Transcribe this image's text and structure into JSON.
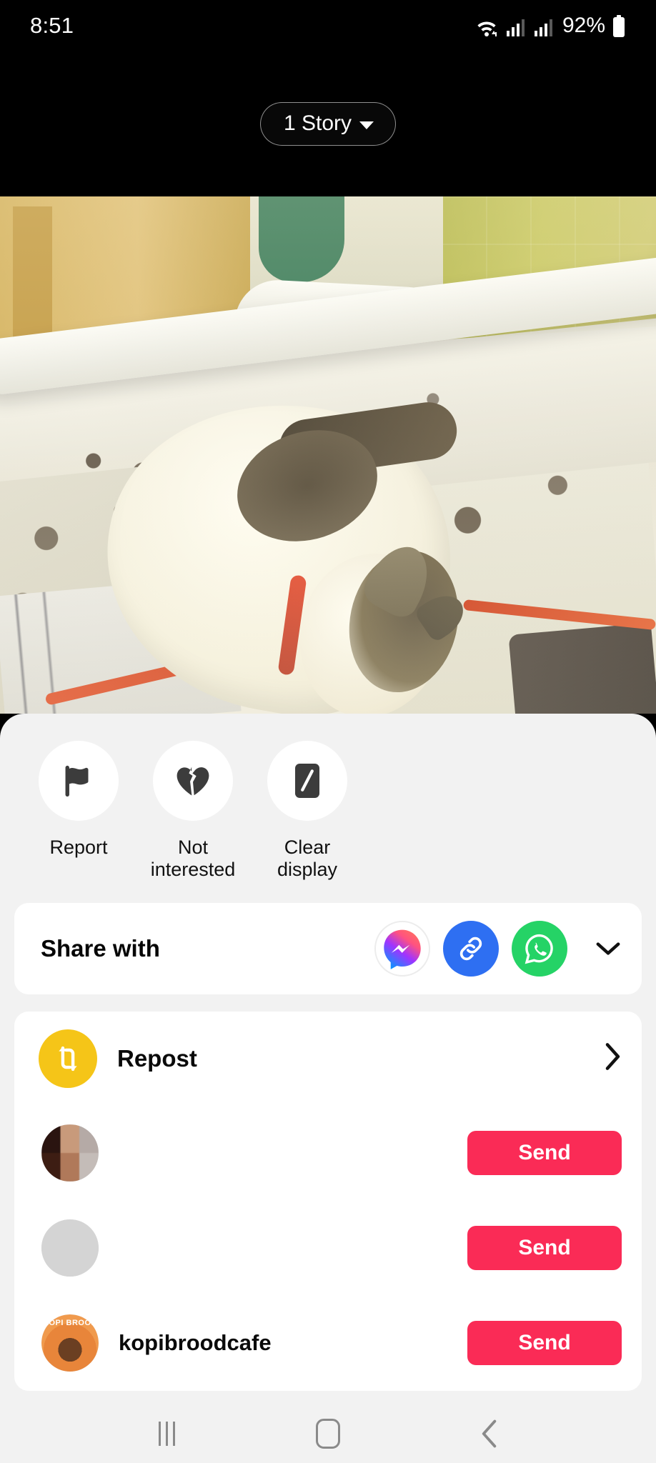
{
  "status_bar": {
    "time": "8:51",
    "battery_percent": "92%",
    "icons": [
      "wifi-icon",
      "signal-icon",
      "signal-icon",
      "battery-icon"
    ]
  },
  "story_header": {
    "label": "1 Story",
    "dropdown_icon": "caret-down-icon"
  },
  "media": {
    "type": "story-photo",
    "description": "White cat with brown tabby markings sleeping on a patterned bed sheet"
  },
  "quick_actions": [
    {
      "label": "Report",
      "icon": "flag-icon"
    },
    {
      "label": "Not\ninterested",
      "label_line1": "Not",
      "label_line2": "interested",
      "icon": "broken-heart-icon"
    },
    {
      "label": "Clear display",
      "label_line1": "Clear",
      "label_line2": "display",
      "icon": "clear-display-icon"
    }
  ],
  "share": {
    "title": "Share with",
    "targets": [
      {
        "name": "Messenger",
        "icon": "messenger-icon",
        "color": "#a033ff"
      },
      {
        "name": "Copy link",
        "icon": "link-icon",
        "color": "#2e6ff2"
      },
      {
        "name": "WhatsApp",
        "icon": "whatsapp-icon",
        "color": "#25d366"
      }
    ],
    "expand_icon": "chevron-down-icon"
  },
  "repost": {
    "label": "Repost",
    "icon": "repost-icon",
    "icon_color": "#f5c518",
    "chevron_icon": "chevron-right-icon"
  },
  "contacts": [
    {
      "name": "",
      "avatar": "redacted-avatar",
      "send_label": "Send"
    },
    {
      "name": "",
      "avatar": "blank-avatar",
      "send_label": "Send"
    },
    {
      "name": "kopibroodcafe",
      "avatar": "kopibrood-logo",
      "send_label": "Send"
    }
  ],
  "nav_bar": {
    "recents_label": "recents-icon",
    "home_label": "home-icon",
    "back_label": "back-icon"
  },
  "colors": {
    "send_button": "#fa2b56",
    "repost_accent": "#f5c518",
    "sheet_background": "#f2f2f2",
    "card_background": "#ffffff",
    "whatsapp": "#25d366",
    "link_blue": "#2e6ff2"
  }
}
